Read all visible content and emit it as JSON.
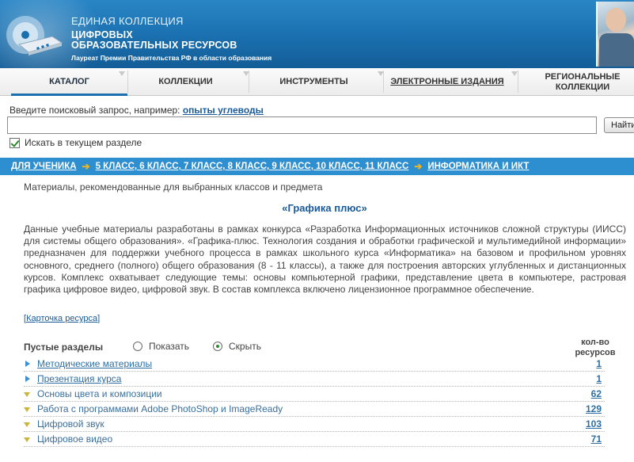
{
  "header": {
    "line1": "ЕДИНАЯ КОЛЛЕКЦИЯ",
    "line2": "ЦИФРОВЫХ",
    "line3": "ОБРАЗОВАТЕЛЬНЫХ РЕСУРСОВ",
    "tagline": "Лауреат Премии Правительства РФ в области образования"
  },
  "nav": {
    "items": [
      {
        "label": "КАТАЛОГ"
      },
      {
        "label": "КОЛЛЕКЦИИ"
      },
      {
        "label": "ИНСТРУМЕНТЫ"
      },
      {
        "label": "ЭЛЕКТРОННЫЕ ИЗДАНИЯ"
      },
      {
        "label": "РЕГИОНАЛЬНЫЕ"
      },
      {
        "label": "КОЛЛЕКЦИИ"
      }
    ]
  },
  "search": {
    "hint": "Введите поисковый запрос, например:",
    "example": "опыты углеводы",
    "value": "",
    "button": "Найти",
    "scope_label": "Искать в текущем разделе",
    "scope_checked": true
  },
  "breadcrumb": {
    "items": [
      "ДЛЯ УЧЕНИКА",
      "5 КЛАСС, 6 КЛАСС, 7 КЛАСС, 8 КЛАСС, 9 КЛАСС, 10 КЛАСС, 11 КЛАСС",
      "ИНФОРМАТИКА И ИКТ"
    ]
  },
  "content": {
    "subtitle": "Материалы, рекомендованные для выбранных классов и предмета",
    "title": "«Графика плюс»",
    "description": "Данные учебные материалы разработаны в рамках конкурса «Разработка Информационных источников сложной структуры (ИИСС) для системы общего образования». «Графика-плюс. Технология создания и обработки графической и мультимедийной информации» предназначен для поддержки учебного процесса в рамках школьного курса «Информатика» на базовом и профильном уровнях основного, среднего (полного) общего образования (8 - 11 классы), а также для построения авторских углубленных и дистанционных курсов. Комплекс охватывает следующие темы: основы компьютерной графики, представление цвета в компьютере, растровая графика цифровое видео, цифровой звук. В состав комплекса включено лицензионное программное обеспечение.",
    "card_link": "Карточка ресурса"
  },
  "sections": {
    "empty_label": "Пустые разделы",
    "show_label": "Показать",
    "hide_label": "Скрыть",
    "count_header_1": "кол-во",
    "count_header_2": "ресурсов",
    "items": [
      {
        "name": "Методические материалы",
        "count": "1",
        "expandable": true
      },
      {
        "name": "Презентация курса",
        "count": "1",
        "expandable": true
      },
      {
        "name": "Основы цвета и композиции",
        "count": "62",
        "expandable": false
      },
      {
        "name": "Работа с программами Adobe PhotoShop и ImageReady",
        "count": "129",
        "expandable": false
      },
      {
        "name": "Цифровой звук",
        "count": "103",
        "expandable": false
      },
      {
        "name": "Цифровое видео",
        "count": "71",
        "expandable": false
      }
    ]
  },
  "colors": {
    "banner": "#1a6fae",
    "breadcrumb": "#2e8fd0",
    "link": "#1a5a98",
    "arrow": "#f3b61f"
  }
}
